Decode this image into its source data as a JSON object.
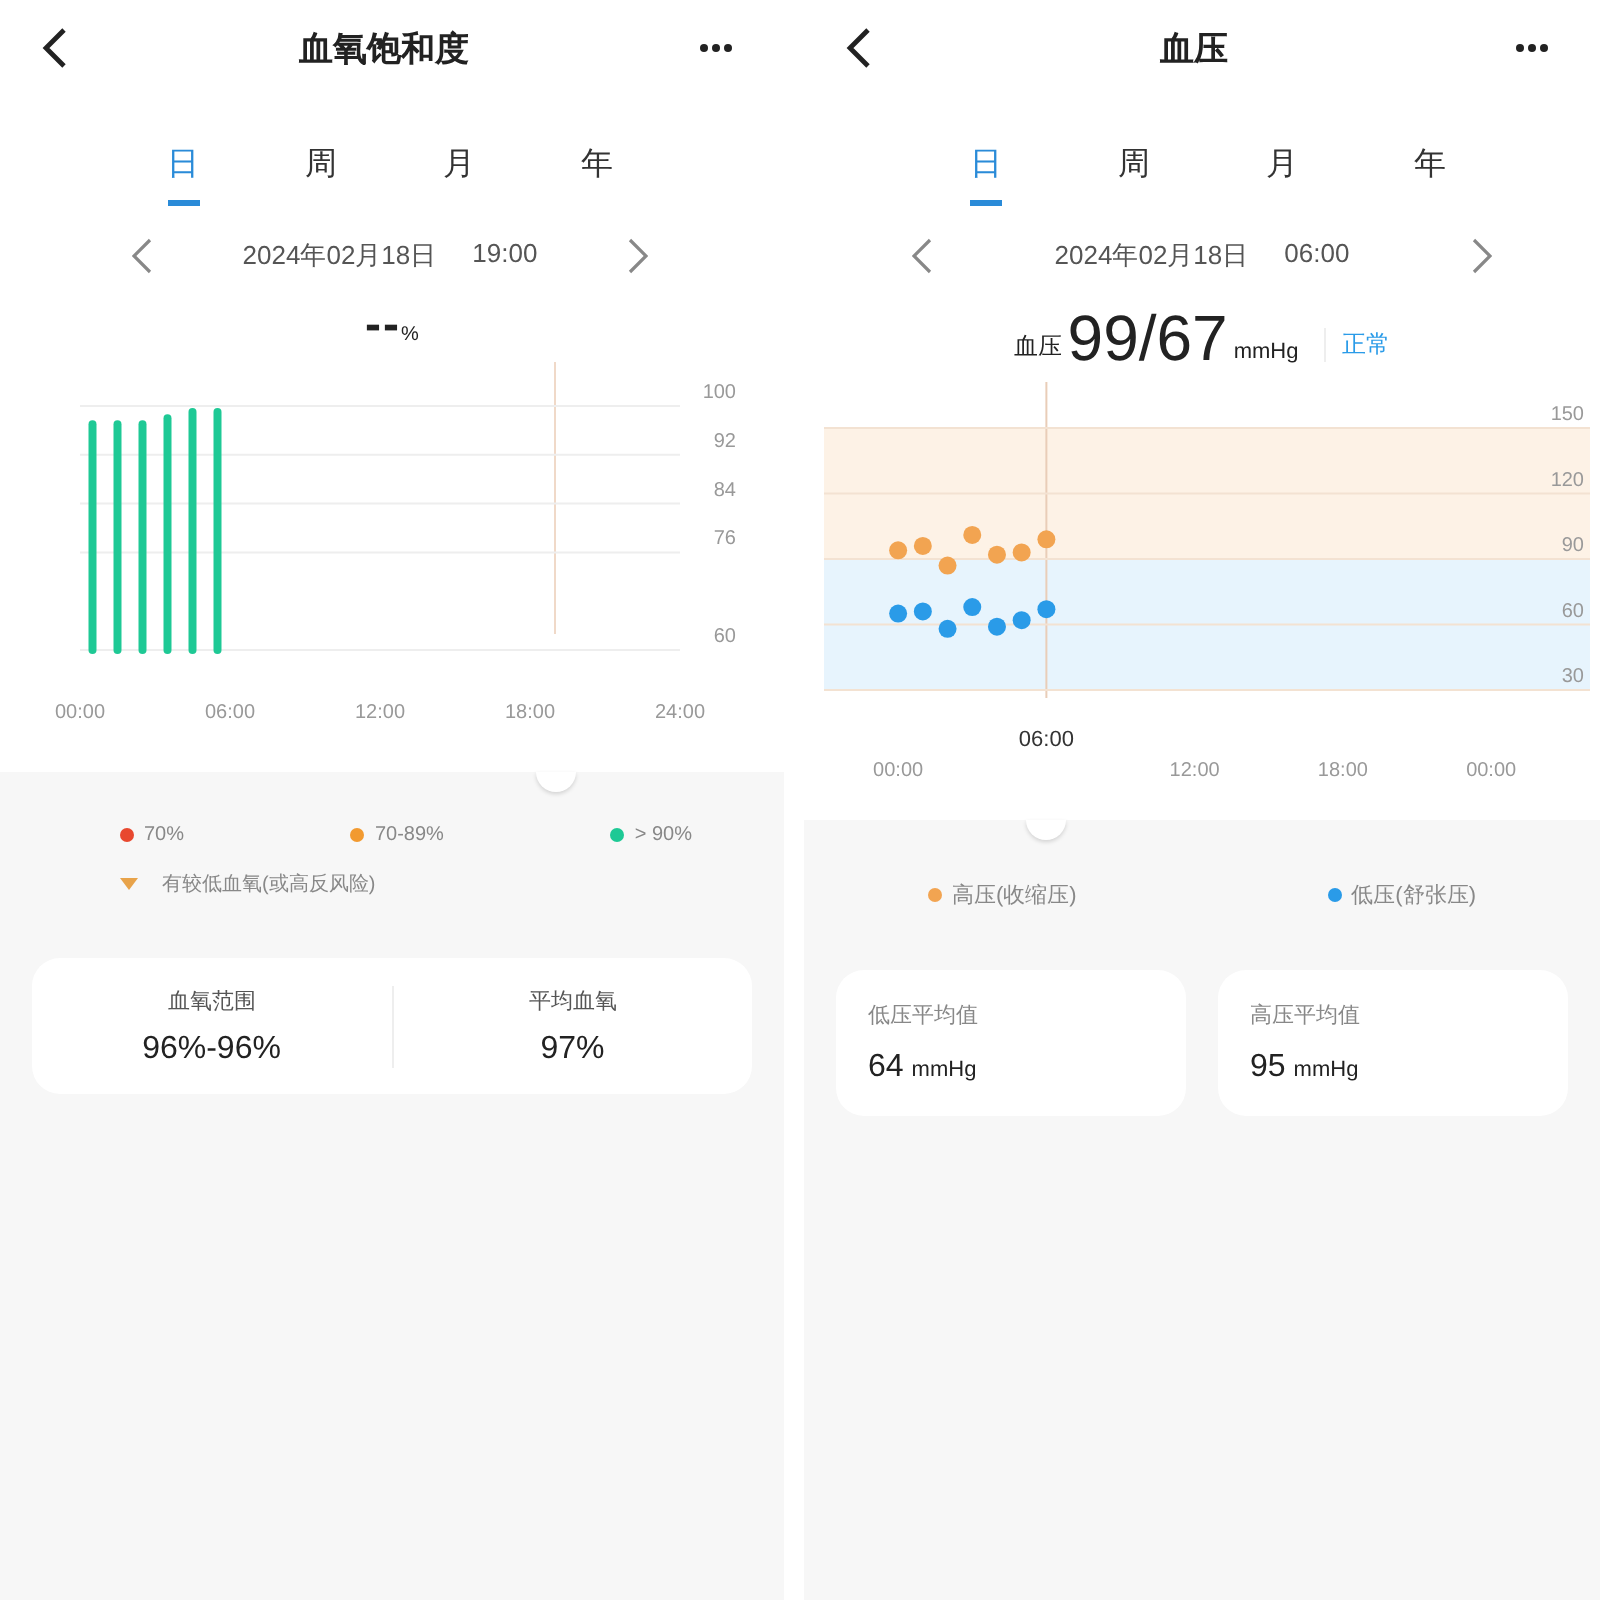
{
  "oxygen_screen": {
    "title": "血氧饱和度",
    "tabs": [
      {
        "label": "日",
        "selected": true
      },
      {
        "label": "周",
        "selected": false
      },
      {
        "label": "月",
        "selected": false
      },
      {
        "label": "年",
        "selected": false
      }
    ],
    "date": "2024年02月18日",
    "time": "19:00",
    "reading": {
      "value": "--",
      "unit": "%"
    },
    "chart_data": {
      "type": "bar",
      "grid": true,
      "xlim": [
        0,
        24
      ],
      "ylim": [
        60,
        100
      ],
      "yticks": [
        100,
        92,
        84,
        76,
        60
      ],
      "x": [
        0.5,
        1.5,
        2.5,
        3.5,
        4.5,
        5.5
      ],
      "xticks": [
        {
          "value": 0,
          "label": "00:00"
        },
        {
          "value": 6,
          "label": "06:00"
        },
        {
          "value": 12,
          "label": "12:00"
        },
        {
          "value": 18,
          "label": "18:00"
        },
        {
          "value": 24,
          "label": "24:00"
        }
      ],
      "series": [
        {
          "color": "#1ec995",
          "values": [
            97,
            97,
            97,
            98,
            99,
            99
          ]
        }
      ]
    },
    "legend": [
      {
        "label": "70%",
        "color": "#e8482f"
      },
      {
        "label": "70-89%",
        "color": "#f29a30"
      },
      {
        "label": "> 90%",
        "color": "#1ec995"
      }
    ],
    "risk_note": "有较低血氧(或高反风险)",
    "stats": [
      {
        "label": "血氧范围",
        "value": "96%-96%"
      },
      {
        "label": "平均血氧",
        "value": "97%"
      }
    ]
  },
  "pressure_screen": {
    "title": "血压",
    "tabs": [
      {
        "label": "日",
        "selected": true
      },
      {
        "label": "周",
        "selected": false
      },
      {
        "label": "月",
        "selected": false
      },
      {
        "label": "年",
        "selected": false
      }
    ],
    "date": "2024年02月18日",
    "time": "06:00",
    "reading": {
      "label": "血压",
      "value": "99/67",
      "unit": "mmHg",
      "status": "正常"
    },
    "chart_data": {
      "type": "scatter",
      "grid": true,
      "xlim": [
        -3,
        28
      ],
      "ylim": [
        30,
        150
      ],
      "yticks": [
        150,
        120,
        90,
        60,
        30
      ],
      "x": [
        0,
        1,
        2,
        3,
        4,
        5,
        6
      ],
      "xticks": [
        {
          "value": 0,
          "label": "00:00"
        },
        {
          "value": 12,
          "label": "12:00"
        },
        {
          "value": 18,
          "label": "18:00"
        },
        {
          "value": 24,
          "label": "00:00"
        }
      ],
      "series": [
        {
          "name": "高压(收缩压)",
          "color": "#f2a451",
          "values": [
            94,
            96,
            87,
            101,
            92,
            93,
            99
          ]
        },
        {
          "name": "低压(舒张压)",
          "color": "#2a9be8",
          "values": [
            65,
            66,
            58,
            68,
            59,
            62,
            67
          ]
        }
      ]
    },
    "cursor_label": "06:00",
    "stats": [
      {
        "label": "低压平均值",
        "value": "64",
        "unit": "mmHg"
      },
      {
        "label": "高压平均值",
        "value": "95",
        "unit": "mmHg"
      }
    ]
  }
}
